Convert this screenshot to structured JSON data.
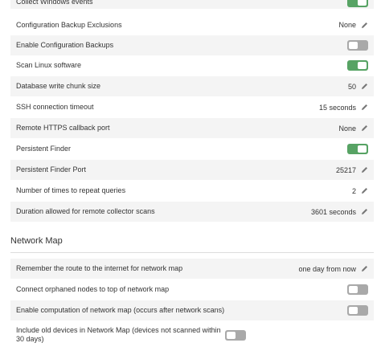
{
  "settings": [
    {
      "label": "Collect Windows events",
      "toggle": "on"
    },
    {
      "label": "Configuration Backup Exclusions",
      "value": "None",
      "editable": true
    },
    {
      "label": "Enable Configuration Backups",
      "toggle": "off"
    },
    {
      "label": "Scan Linux software",
      "toggle": "on"
    },
    {
      "label": "Database write chunk size",
      "value": "50",
      "editable": true
    },
    {
      "label": "SSH connection timeout",
      "value": "15 seconds",
      "editable": true
    },
    {
      "label": "Remote HTTPS callback port",
      "value": "None",
      "editable": true
    },
    {
      "label": "Persistent Finder",
      "toggle": "on"
    },
    {
      "label": "Persistent Finder Port",
      "value": "25217",
      "editable": true
    },
    {
      "label": "Number of times to repeat queries",
      "value": "2",
      "editable": true
    },
    {
      "label": "Duration allowed for remote collector scans",
      "value": "3601 seconds",
      "editable": true
    }
  ],
  "network_map": {
    "title": "Network Map",
    "settings": [
      {
        "label": "Remember the route to the internet for network map",
        "value": "one day from now",
        "editable": true
      },
      {
        "label": "Connect orphaned nodes to top of network map",
        "toggle": "off"
      },
      {
        "label": "Enable computation of network map (occurs after network scans)",
        "toggle": "off"
      },
      {
        "label": "Include old devices in Network Map (devices not scanned within 30 days)",
        "toggle": "off"
      }
    ]
  },
  "colors": {
    "toggle_on": "#57a364",
    "toggle_off": "#a9a9a9",
    "row_shade": "#f4f4f4"
  },
  "icons": {
    "edit": "pencil-icon"
  }
}
